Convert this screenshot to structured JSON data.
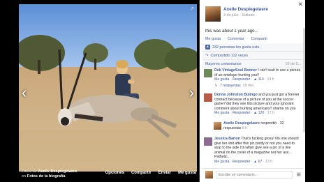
{
  "viewer": {
    "caption_prefix": "Fotos de",
    "caption_owner": "Axelle Despiegelaere",
    "caption_line2": "en",
    "caption_album": "Fotos de la biografía",
    "actions": [
      "Opciones",
      "Compartir",
      "Enviar",
      "Me gusta"
    ]
  },
  "post": {
    "author": "Axelle Despiegelaere",
    "meta": "3 de julio · Editado ·",
    "text": "this was about 1 year ago...",
    "actions": [
      "Me gusta",
      "Comentar",
      "Compartir"
    ]
  },
  "ufi": {
    "likes": "232 personas les gusta esto.",
    "shares": "Compartido 112 veces",
    "prev_comments": "Mayores comentarios",
    "prev_count": "10 de 9...",
    "like_icon": "thumbs-up-icon"
  },
  "comments": [
    {
      "name": "Deb VintageSoul Bonner",
      "text": "I can't wait to see a picture of an antelope hunting you!!",
      "meta_like": "Me gusta",
      "meta_reply": "Responder",
      "meta_count": "114",
      "meta_time": "14 h",
      "replies": "7 respuestas",
      "reply_time": "39 min",
      "avatar_color": "#6f8a5a"
    },
    {
      "name": "Donna Johnston Bulingo",
      "text": "and you just got a forever contract because of a picture of you at the soccer game? did they see this picture and your ignorant comment about hunting americans? shame on you",
      "meta_like": "Me gusta",
      "meta_reply": "Responder",
      "meta_count": "120",
      "meta_time": "17 h",
      "avatar_color": "#b85c4a"
    },
    {
      "name": "Jessica Barton",
      "text": "That's fucking gross! No one should give her shit after this pic pretty or not you need to stop to the side I'd rather give see a pic of a live animal on the cover of a magazine not her ass... Pathetic...",
      "meta_like": "Me gusta",
      "meta_reply": "Responder",
      "meta_count": "67",
      "meta_time": "13 h",
      "avatar_color": "#8a6a8e"
    }
  ],
  "nested_reply": {
    "name": "Axelle Despiegelaere",
    "text": "respondió · 32 respuestas",
    "time": "8 h"
  },
  "composer": {
    "placeholder": "Escribe un comentario...",
    "camera_icon": "camera-icon"
  },
  "icons": {
    "close": "close-icon",
    "expand": "expand-icon",
    "prev": "chevron-left-icon",
    "next": "chevron-right-icon"
  }
}
